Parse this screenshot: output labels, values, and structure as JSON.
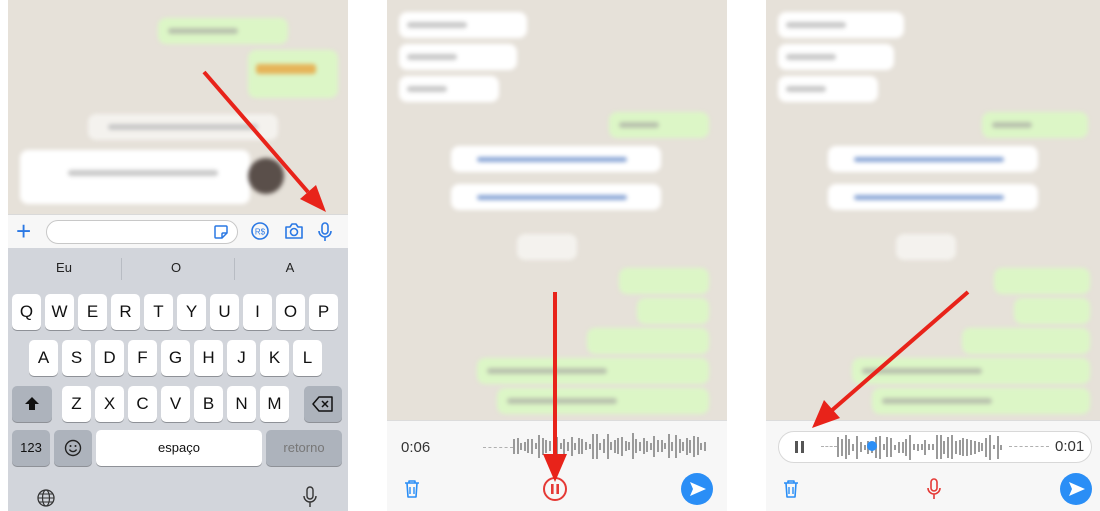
{
  "panel1": {
    "suggestions": [
      "Eu",
      "O",
      "A"
    ],
    "row1": [
      "Q",
      "W",
      "E",
      "R",
      "T",
      "Y",
      "U",
      "I",
      "O",
      "P"
    ],
    "row2": [
      "A",
      "S",
      "D",
      "F",
      "G",
      "H",
      "J",
      "K",
      "L"
    ],
    "row3": [
      "Z",
      "X",
      "C",
      "V",
      "B",
      "N",
      "M"
    ],
    "numbers_key": "123",
    "space_key": "espaço",
    "return_key": "retorno"
  },
  "panel2": {
    "elapsed": "0:06"
  },
  "panel3": {
    "elapsed": "0:01"
  },
  "colors": {
    "accent": "#2a8ef6",
    "record_red": "#e53935",
    "arrow_red": "#e8231a"
  }
}
